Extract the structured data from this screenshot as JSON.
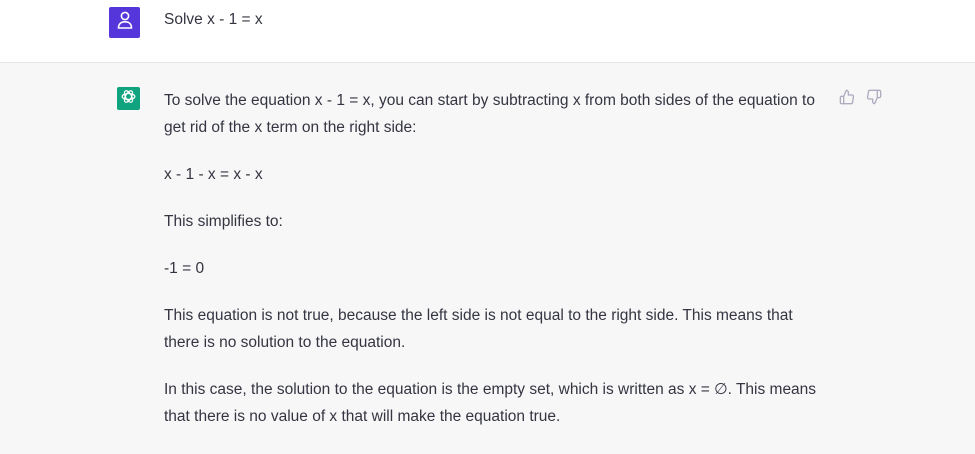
{
  "theme": {
    "user_avatar_color": "#5436da",
    "bot_avatar_color": "#10a37f",
    "icon_gray": "#acacbe"
  },
  "user_message": {
    "avatar_icon": "user-icon",
    "text": "Solve x - 1 = x"
  },
  "assistant_message": {
    "avatar_icon": "openai-logo-icon",
    "paragraphs": [
      "To solve the equation x - 1 = x, you can start by subtracting x from both sides of the equation to get rid of the x term on the right side:",
      "x - 1 - x = x - x",
      "This simplifies to:",
      "-1 = 0",
      "This equation is not true, because the left side is not equal to the right side. This means that there is no solution to the equation.",
      "In this case, the solution to the equation is the empty set, which is written as x = ∅. This means that there is no value of x that will make the equation true."
    ],
    "feedback": {
      "like_icon": "thumbs-up-icon",
      "dislike_icon": "thumbs-down-icon"
    }
  }
}
